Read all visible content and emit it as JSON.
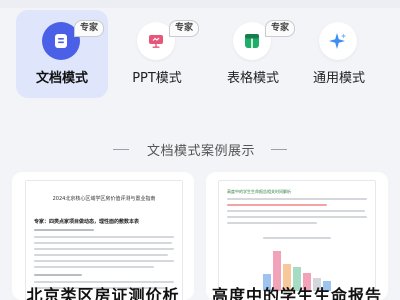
{
  "modes": [
    {
      "label": "文档模式",
      "badge": "专家",
      "icon": "doc-icon",
      "active": true
    },
    {
      "label": "PPT模式",
      "badge": "专家",
      "icon": "ppt-icon",
      "active": false
    },
    {
      "label": "表格模式",
      "badge": "专家",
      "icon": "table-icon",
      "active": false
    },
    {
      "label": "通用模式",
      "badge": "",
      "icon": "sparkle-icon",
      "active": false
    }
  ],
  "colors": {
    "accent": "#4a60e6",
    "pink": "#e8557a",
    "green": "#1fae6a",
    "blue": "#3d8ef0"
  },
  "section_title": "文档模式案例展示",
  "cards": [
    {
      "title": "北京类区房证测价析",
      "doc_title": "2024北京核心区域学区房价值评测与置业指南",
      "doc_subtitle": "专家：四类点家项目做动态，理性面的敷数本表"
    },
    {
      "title": "高度中的学生生命报告",
      "doc_subtitle": "高度中的学生生命报告相关时间解析",
      "chart_values": [
        0.38,
        0.9,
        0.62,
        0.55,
        0.4,
        0.3,
        0.22
      ]
    }
  ]
}
